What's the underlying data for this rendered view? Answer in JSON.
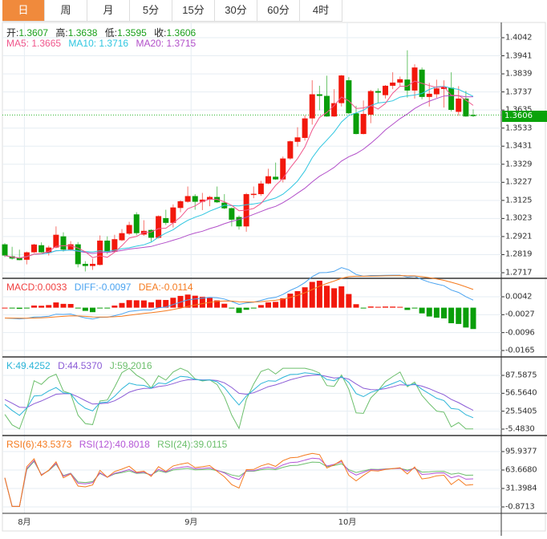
{
  "tabs": [
    "日",
    "周",
    "月",
    "5分",
    "15分",
    "30分",
    "60分",
    "4时"
  ],
  "active_tab": 0,
  "ohlc_label": {
    "open_k": "开:",
    "open": "1.3607",
    "high_k": "高:",
    "high": "1.3638",
    "low_k": "低:",
    "low": "1.3595",
    "close_k": "收:",
    "close": "1.3606"
  },
  "ma_label": {
    "ma5": "MA5: 1.3665",
    "ma10": "MA10: 1.3716",
    "ma20": "MA20: 1.3715"
  },
  "macd_label": {
    "macd": "MACD:0.0033",
    "diff": "DIFF:-0.0097",
    "dea": "DEA:-0.0114"
  },
  "kdj_label": {
    "k": "K:49.4252",
    "d": "D:44.5370",
    "j": "J:59.2016"
  },
  "rsi_label": {
    "rsi6": "RSI(6):43.5373",
    "rsi12": "RSI(12):40.8018",
    "rsi24": "RSI(24):39.0115"
  },
  "last_price": "1.3606",
  "colors": {
    "up": "#f2180c",
    "down": "#0a9e0a",
    "ma5": "#f0578c",
    "ma10": "#2ec6e0",
    "ma20": "#b24fc9",
    "accent": "#f08a3c"
  },
  "chart_data": {
    "type": "candlestick",
    "x_month_labels": [
      {
        "label": "8月",
        "index": 3
      },
      {
        "label": "9月",
        "index": 26
      },
      {
        "label": "10月",
        "index": 48
      }
    ],
    "price_axis": {
      "ticks": [
        "1.4042",
        "1.3941",
        "1.3839",
        "1.3737",
        "1.3635",
        "1.3533",
        "1.3431",
        "1.3329",
        "1.3227",
        "1.3125",
        "1.3023",
        "1.2921",
        "1.2819",
        "1.2717"
      ],
      "range": [
        1.2717,
        1.4042
      ]
    },
    "macd_axis": {
      "ticks": [
        "0.0042",
        "-0.0027",
        "-0.0096",
        "-0.0165"
      ],
      "range": [
        -0.0165,
        0.0042
      ]
    },
    "kdj_axis": {
      "ticks": [
        "87.5875",
        "56.5640",
        "25.5405",
        "-5.4830"
      ],
      "range": [
        -5.483,
        87.5875
      ]
    },
    "rsi_axis": {
      "ticks": [
        "95.9377",
        "63.6680",
        "31.3984",
        "-0.8713"
      ],
      "range": [
        -0.8713,
        95.9377
      ]
    },
    "candles": [
      [
        1.2877,
        1.2884,
        1.2805,
        1.2814
      ],
      [
        1.281,
        1.2863,
        1.2791,
        1.2797
      ],
      [
        1.28,
        1.2847,
        1.2787,
        1.2788
      ],
      [
        1.279,
        1.2836,
        1.2764,
        1.2832
      ],
      [
        1.2832,
        1.288,
        1.2828,
        1.2876
      ],
      [
        1.2872,
        1.2888,
        1.283,
        1.2832
      ],
      [
        1.2829,
        1.2869,
        1.2814,
        1.2859
      ],
      [
        1.2859,
        1.2978,
        1.2855,
        1.2931
      ],
      [
        1.2922,
        1.2945,
        1.2836,
        1.2847
      ],
      [
        1.2847,
        1.2895,
        1.2841,
        1.2877
      ],
      [
        1.2877,
        1.289,
        1.2747,
        1.2765
      ],
      [
        1.2767,
        1.2782,
        1.2724,
        1.2755
      ],
      [
        1.2755,
        1.2796,
        1.2733,
        1.2767
      ],
      [
        1.2761,
        1.2927,
        1.2758,
        1.2898
      ],
      [
        1.2898,
        1.2922,
        1.2823,
        1.2835
      ],
      [
        1.2835,
        1.2931,
        1.283,
        1.2906
      ],
      [
        1.29,
        1.2963,
        1.2895,
        1.294
      ],
      [
        1.2937,
        1.3004,
        1.293,
        1.2986
      ],
      [
        1.3046,
        1.3058,
        1.2928,
        1.294
      ],
      [
        1.2932,
        1.3013,
        1.2925,
        1.2953
      ],
      [
        1.2958,
        1.2962,
        1.2892,
        1.2914
      ],
      [
        1.2914,
        1.304,
        1.291,
        1.3036
      ],
      [
        1.3025,
        1.3072,
        1.2986,
        1.2998
      ],
      [
        1.2998,
        1.3102,
        1.2972,
        1.3085
      ],
      [
        1.3082,
        1.3125,
        1.3058,
        1.312
      ],
      [
        1.3117,
        1.3203,
        1.3112,
        1.3149
      ],
      [
        1.3149,
        1.316,
        1.3072,
        1.3117
      ],
      [
        1.3117,
        1.3167,
        1.307,
        1.3129
      ],
      [
        1.3129,
        1.315,
        1.3092,
        1.3144
      ],
      [
        1.3144,
        1.3203,
        1.311,
        1.3114
      ],
      [
        1.3112,
        1.316,
        1.3075,
        1.308
      ],
      [
        1.3081,
        1.3085,
        1.2978,
        1.3016
      ],
      [
        1.3031,
        1.304,
        1.296,
        1.2978
      ],
      [
        1.2978,
        1.3167,
        1.2948,
        1.316
      ],
      [
        1.3158,
        1.3203,
        1.3137,
        1.3162
      ],
      [
        1.316,
        1.3235,
        1.315,
        1.322
      ],
      [
        1.322,
        1.3303,
        1.3216,
        1.3261
      ],
      [
        1.3258,
        1.3338,
        1.324,
        1.3243
      ],
      [
        1.3243,
        1.3372,
        1.3226,
        1.3361
      ],
      [
        1.3361,
        1.3462,
        1.3354,
        1.3458
      ],
      [
        1.3455,
        1.3537,
        1.3428,
        1.348
      ],
      [
        1.3477,
        1.3605,
        1.3462,
        1.3587
      ],
      [
        1.3587,
        1.3802,
        1.3552,
        1.3723
      ],
      [
        1.3723,
        1.3771,
        1.3633,
        1.3714
      ],
      [
        1.3714,
        1.3828,
        1.3596,
        1.3598
      ],
      [
        1.3598,
        1.3752,
        1.3596,
        1.3673
      ],
      [
        1.3673,
        1.3832,
        1.3654,
        1.3829
      ],
      [
        1.3802,
        1.382,
        1.361,
        1.3616
      ],
      [
        1.3616,
        1.3658,
        1.3497,
        1.3499
      ],
      [
        1.3499,
        1.3688,
        1.3497,
        1.3612
      ],
      [
        1.3608,
        1.3748,
        1.356,
        1.3741
      ],
      [
        1.3741,
        1.3756,
        1.3673,
        1.3732
      ],
      [
        1.3718,
        1.3775,
        1.3699,
        1.3771
      ],
      [
        1.3771,
        1.3847,
        1.3752,
        1.3789
      ],
      [
        1.3789,
        1.3823,
        1.3771,
        1.3808
      ],
      [
        1.3806,
        1.3971,
        1.3704,
        1.3744
      ],
      [
        1.3744,
        1.3892,
        1.3699,
        1.3874
      ],
      [
        1.3862,
        1.3874,
        1.3695,
        1.3708
      ],
      [
        1.3708,
        1.3787,
        1.3654,
        1.3726
      ],
      [
        1.3723,
        1.3805,
        1.3703,
        1.3756
      ],
      [
        1.3753,
        1.3802,
        1.3648,
        1.3764
      ],
      [
        1.376,
        1.3847,
        1.3626,
        1.3635
      ],
      [
        1.3624,
        1.3769,
        1.3602,
        1.3699
      ],
      [
        1.3699,
        1.3742,
        1.3596,
        1.3598
      ],
      [
        1.3607,
        1.3638,
        1.3595,
        1.3606
      ]
    ],
    "candle_format": [
      "open",
      "high",
      "low",
      "close"
    ]
  }
}
